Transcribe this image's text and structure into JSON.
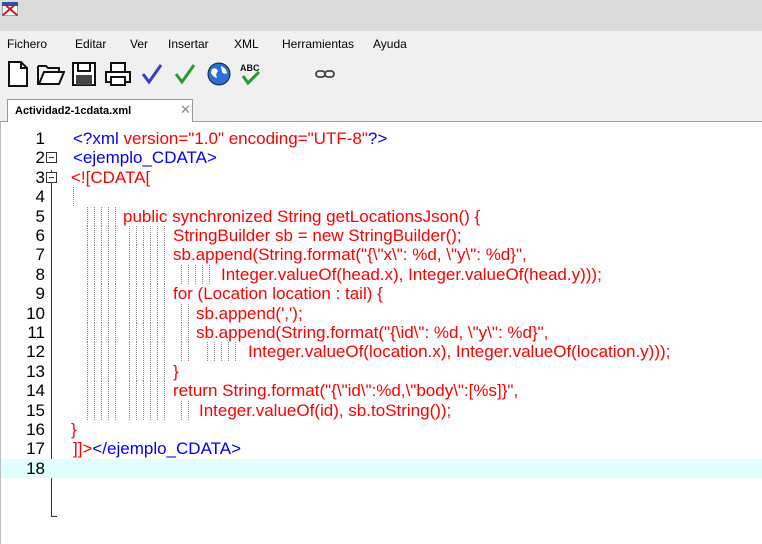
{
  "menu": [
    "Fichero",
    "Editar",
    "Ver",
    "Insertar",
    "XML",
    "Herramientas",
    "Ayuda"
  ],
  "toolbar": {
    "icons": [
      "new-document-icon",
      "open-folder-icon",
      "save-icon",
      "print-icon",
      "check-wellformed-icon",
      "validate-icon",
      "web-preview-icon",
      "spellcheck-icon",
      "link-icon"
    ],
    "spellcheck_text": "ABC"
  },
  "tab": {
    "label": "Actividad2-1cdata.xml",
    "close": "✕"
  },
  "editor": {
    "lines": [
      {
        "n": "1",
        "parts": [
          [
            "<?xml",
            "blue"
          ],
          [
            " version=\"1.0\" encoding=\"UTF-8\"",
            "red"
          ],
          [
            "?>",
            "blue"
          ]
        ]
      },
      {
        "n": "2",
        "parts": [
          [
            "<ejemplo_CDATA>",
            "blue"
          ]
        ]
      },
      {
        "n": "3",
        "parts": [
          [
            "<![CDATA[",
            "red"
          ]
        ]
      },
      {
        "n": "4",
        "parts": []
      },
      {
        "n": "5",
        "parts": [
          [
            "public synchronized String getLocationsJson() {",
            "red"
          ]
        ]
      },
      {
        "n": "6",
        "parts": [
          [
            "StringBuilder sb = new StringBuilder();",
            "red"
          ]
        ]
      },
      {
        "n": "7",
        "parts": [
          [
            "sb.append(String.format(\"{\\\"x\\\": %d, \\\"y\\\": %d}\",",
            "red"
          ]
        ]
      },
      {
        "n": "8",
        "parts": [
          [
            "Integer.valueOf(head.x), Integer.valueOf(head.y)));",
            "red"
          ]
        ]
      },
      {
        "n": "9",
        "parts": [
          [
            "for (Location location : tail) {",
            "red"
          ]
        ]
      },
      {
        "n": "10",
        "parts": [
          [
            "sb.append(',');",
            "red"
          ]
        ]
      },
      {
        "n": "11",
        "parts": [
          [
            "sb.append(String.format(\"{\\id\\\": %d, \\\"y\\\": %d}\",",
            "red"
          ]
        ]
      },
      {
        "n": "12",
        "parts": [
          [
            "Integer.valueOf(location.x), Integer.valueOf(location.y)));",
            "red"
          ]
        ]
      },
      {
        "n": "13",
        "parts": [
          [
            "}",
            "red"
          ]
        ]
      },
      {
        "n": "14",
        "parts": [
          [
            "return String.format(\"{\\\"id\\\":%d,\\\"body\\\":[%s]}\",",
            "red"
          ]
        ]
      },
      {
        "n": "15",
        "parts": [
          [
            "Integer.valueOf(id), sb.toString());",
            "red"
          ]
        ]
      },
      {
        "n": "16",
        "parts": [
          [
            "}",
            "red"
          ]
        ]
      },
      {
        "n": "17",
        "parts": [
          [
            "]]>",
            "red"
          ],
          [
            "</ejemplo_CDATA>",
            "blue"
          ]
        ]
      },
      {
        "n": "18",
        "parts": []
      }
    ]
  }
}
